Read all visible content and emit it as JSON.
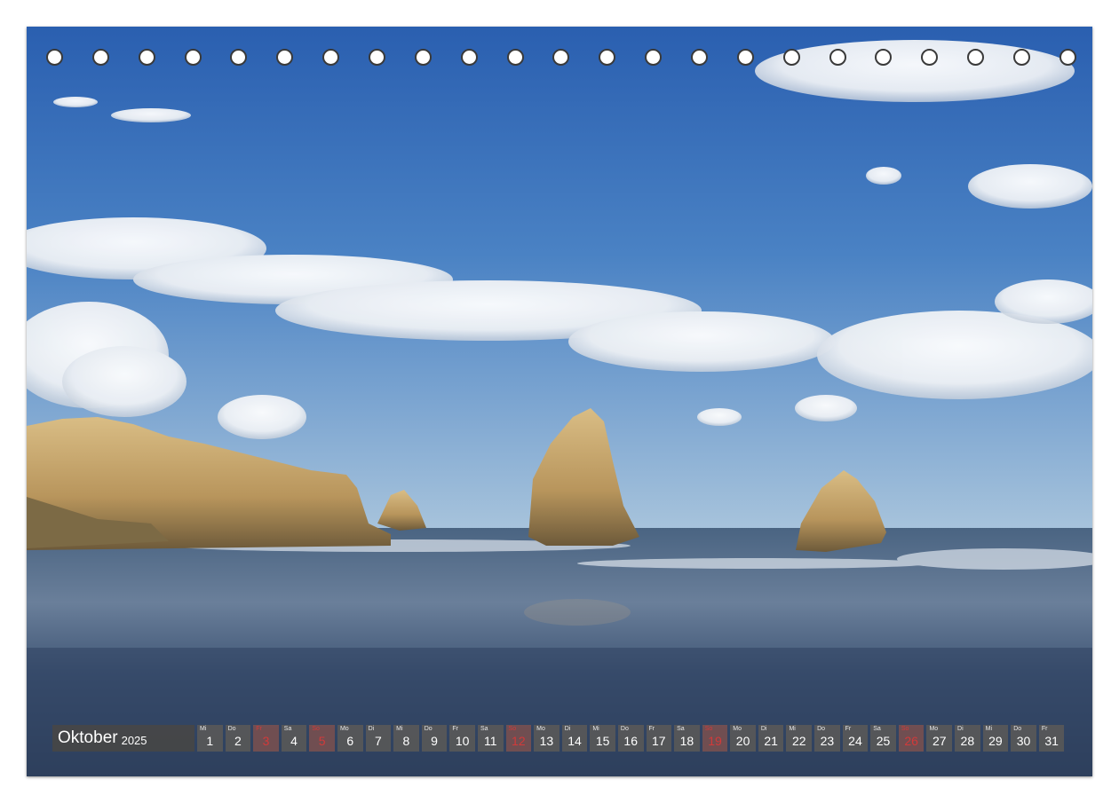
{
  "calendar": {
    "month": "Oktober",
    "year": "2025",
    "days": [
      {
        "wd": "Mi",
        "d": "1",
        "sun": false
      },
      {
        "wd": "Do",
        "d": "2",
        "sun": false
      },
      {
        "wd": "Fr",
        "d": "3",
        "sun": true
      },
      {
        "wd": "Sa",
        "d": "4",
        "sun": false
      },
      {
        "wd": "So",
        "d": "5",
        "sun": true
      },
      {
        "wd": "Mo",
        "d": "6",
        "sun": false
      },
      {
        "wd": "Di",
        "d": "7",
        "sun": false
      },
      {
        "wd": "Mi",
        "d": "8",
        "sun": false
      },
      {
        "wd": "Do",
        "d": "9",
        "sun": false
      },
      {
        "wd": "Fr",
        "d": "10",
        "sun": false
      },
      {
        "wd": "Sa",
        "d": "11",
        "sun": false
      },
      {
        "wd": "So",
        "d": "12",
        "sun": true
      },
      {
        "wd": "Mo",
        "d": "13",
        "sun": false
      },
      {
        "wd": "Di",
        "d": "14",
        "sun": false
      },
      {
        "wd": "Mi",
        "d": "15",
        "sun": false
      },
      {
        "wd": "Do",
        "d": "16",
        "sun": false
      },
      {
        "wd": "Fr",
        "d": "17",
        "sun": false
      },
      {
        "wd": "Sa",
        "d": "18",
        "sun": false
      },
      {
        "wd": "So",
        "d": "19",
        "sun": true
      },
      {
        "wd": "Mo",
        "d": "20",
        "sun": false
      },
      {
        "wd": "Di",
        "d": "21",
        "sun": false
      },
      {
        "wd": "Mi",
        "d": "22",
        "sun": false
      },
      {
        "wd": "Do",
        "d": "23",
        "sun": false
      },
      {
        "wd": "Fr",
        "d": "24",
        "sun": false
      },
      {
        "wd": "Sa",
        "d": "25",
        "sun": false
      },
      {
        "wd": "So",
        "d": "26",
        "sun": true
      },
      {
        "wd": "Mo",
        "d": "27",
        "sun": false
      },
      {
        "wd": "Di",
        "d": "28",
        "sun": false
      },
      {
        "wd": "Mi",
        "d": "29",
        "sun": false
      },
      {
        "wd": "Do",
        "d": "30",
        "sun": false
      },
      {
        "wd": "Fr",
        "d": "31",
        "sun": false
      }
    ]
  },
  "binding_holes": 23,
  "colors": {
    "sky_top": "#2e64b4",
    "sky_bottom": "#a9c6df",
    "sea": "#3d5577",
    "rock": "#c9a86a",
    "sunday_text": "#d23a3a"
  }
}
